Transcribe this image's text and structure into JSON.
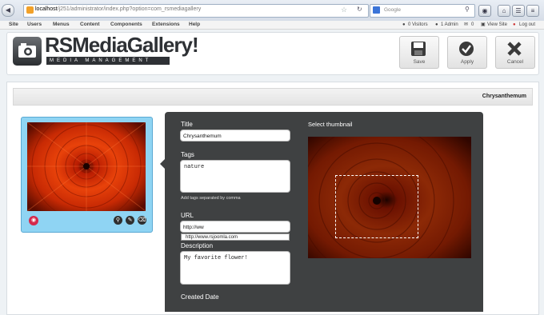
{
  "browser": {
    "url_host": "localhost",
    "url_path": "/j251/administrator/index.php?option=com_rsmediagallery",
    "search_placeholder": "Google"
  },
  "admin_menu": {
    "items": [
      "Site",
      "Users",
      "Menus",
      "Content",
      "Components",
      "Extensions",
      "Help"
    ],
    "status": {
      "visitors": "0 Visitors",
      "admins": "1 Admin",
      "messages": "0",
      "view_site": "View Site",
      "logout": "Log out"
    }
  },
  "header": {
    "logo_title": "RSMediaGallery!",
    "logo_subtitle": "MEDIA MANAGEMENT"
  },
  "toolbar": {
    "save_label": "Save",
    "apply_label": "Apply",
    "cancel_label": "Cancel"
  },
  "content": {
    "image_name": "Chrysanthemum"
  },
  "form": {
    "title_label": "Title",
    "title_value": "Chrysanthemum",
    "tags_label": "Tags",
    "tags_value": "nature",
    "tags_help": "Add tags separated by comma",
    "url_label": "URL",
    "url_value": "http://ww",
    "url_suggestion": "http://www.rsjoomla.com",
    "description_label": "Description",
    "description_value": "My favorite flower!",
    "created_date_label": "Created Date",
    "thumbnail_label": "Select thumbnail"
  },
  "colors": {
    "panel_bg": "#3f4142",
    "card_bg": "#8fd4f3",
    "eye_button": "#d4294b"
  },
  "icons": [
    "back-icon",
    "forward-icon",
    "joomla-icon",
    "star-icon",
    "reload-icon",
    "google-icon",
    "search-icon",
    "home-icon",
    "save-icon",
    "check-icon",
    "close-icon",
    "eye-icon",
    "zoom-icon",
    "edit-icon",
    "delete-icon",
    "camera-icon"
  ]
}
